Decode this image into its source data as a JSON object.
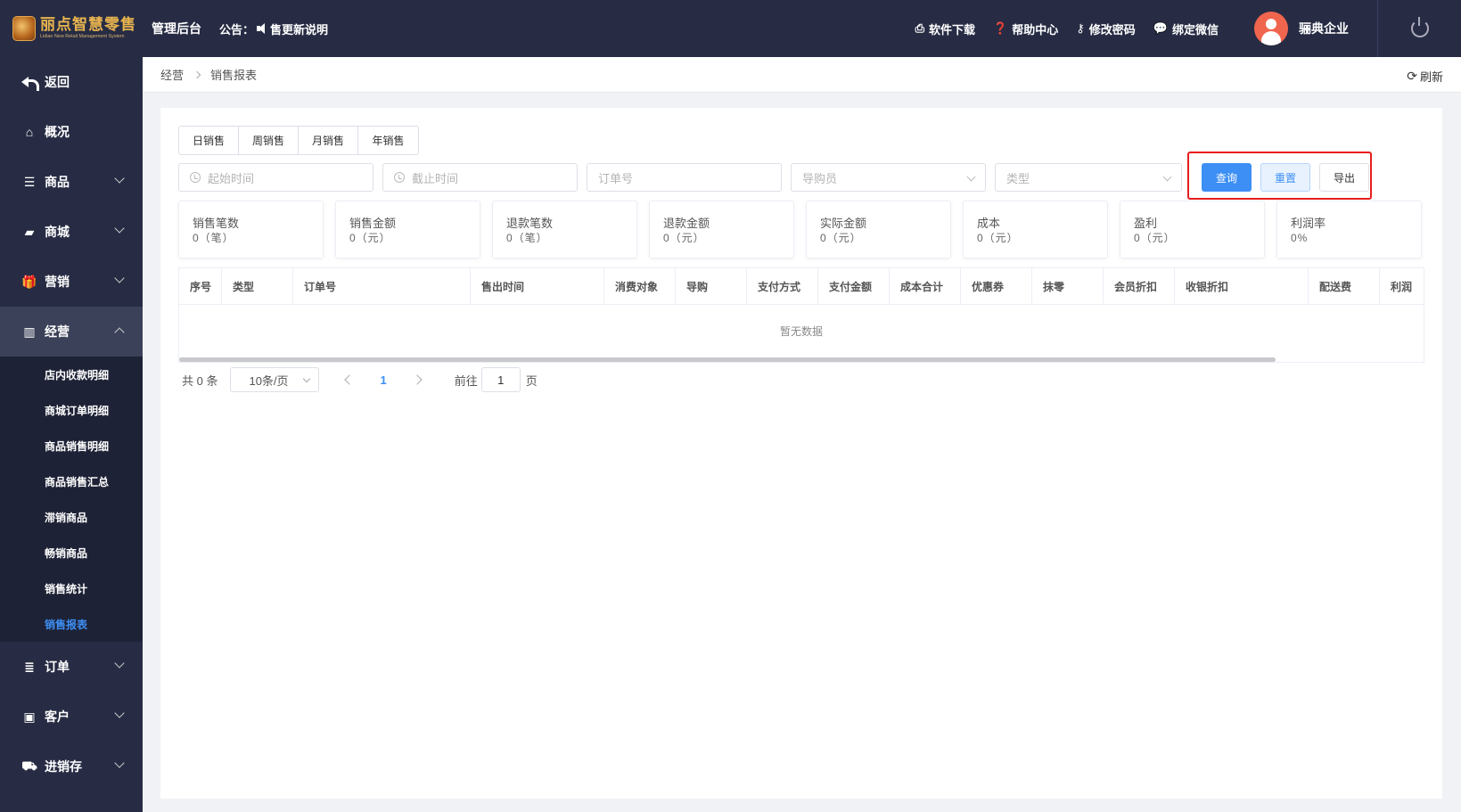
{
  "header": {
    "logo_title": "丽点智慧零售",
    "logo_sub": "Lidian New Retail Management System",
    "admin_label": "管理后台",
    "notice_prefix": "公告：",
    "notice_text": "售更新说明",
    "links": [
      {
        "icon": "printer-icon",
        "label": "软件下载"
      },
      {
        "icon": "help-icon",
        "label": "帮助中心"
      },
      {
        "icon": "key-icon",
        "label": "修改密码"
      },
      {
        "icon": "wechat-icon",
        "label": "绑定微信"
      }
    ],
    "username": "骊典企业"
  },
  "sidebar": {
    "back": "返回",
    "items": [
      {
        "icon": "home-icon",
        "label": "概况"
      },
      {
        "icon": "list-icon",
        "label": "商品"
      },
      {
        "icon": "shop-icon",
        "label": "商城"
      },
      {
        "icon": "gift-icon",
        "label": "营销"
      },
      {
        "icon": "chart-icon",
        "label": "经营"
      }
    ],
    "sub_items": [
      "店内收款明细",
      "商城订单明细",
      "商品销售明细",
      "商品销售汇总",
      "滞销商品",
      "畅销商品",
      "销售统计",
      "销售报表"
    ],
    "bottom_items": [
      {
        "icon": "order-icon",
        "label": "订单"
      },
      {
        "icon": "customer-icon",
        "label": "客户"
      },
      {
        "icon": "truck-icon",
        "label": "进销存"
      }
    ]
  },
  "breadcrumb": {
    "parent": "经营",
    "current": "销售报表",
    "refresh": "刷新"
  },
  "tabs": [
    "日销售",
    "周销售",
    "月销售",
    "年销售"
  ],
  "filters": {
    "start_time": "起始时间",
    "end_time": "截止时间",
    "order_no": "订单号",
    "guide": "导购员",
    "type": "类型"
  },
  "buttons": {
    "query": "查询",
    "reset": "重置",
    "export": "导出"
  },
  "stats": [
    {
      "label": "销售笔数",
      "value": "0（笔）"
    },
    {
      "label": "销售金额",
      "value": "0（元）"
    },
    {
      "label": "退款笔数",
      "value": "0（笔）"
    },
    {
      "label": "退款金额",
      "value": "0（元）"
    },
    {
      "label": "实际金额",
      "value": "0（元）"
    },
    {
      "label": "成本",
      "value": "0（元）"
    },
    {
      "label": "盈利",
      "value": "0（元）"
    },
    {
      "label": "利润率",
      "value": "0%"
    }
  ],
  "table": {
    "columns": [
      "序号",
      "类型",
      "订单号",
      "售出时间",
      "消费对象",
      "导购",
      "支付方式",
      "支付金额",
      "成本合计",
      "优惠券",
      "抹零",
      "会员折扣",
      "收银折扣",
      "配送费",
      "利润"
    ],
    "empty_text": "暂无数据"
  },
  "pager": {
    "total": "共 0 条",
    "page_size": "10条/页",
    "current_page": "1",
    "goto_label": "前往",
    "goto_value": "1",
    "unit": "页"
  },
  "colors": {
    "nav_bg": "#272c44",
    "accent": "#3d8ff5",
    "highlight_box": "#e61e1e"
  }
}
